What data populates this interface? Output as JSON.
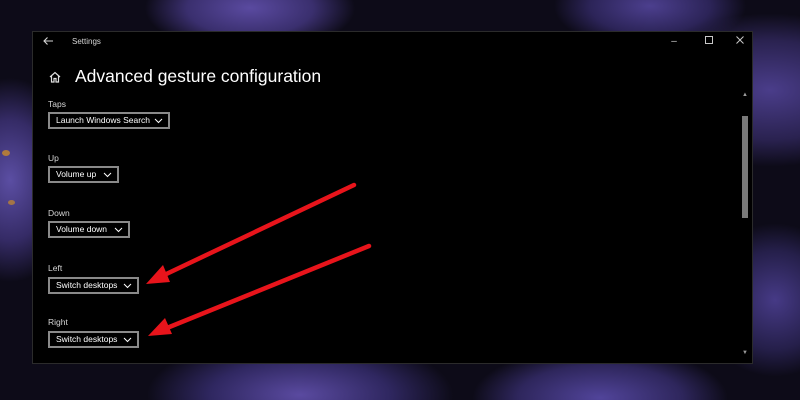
{
  "window": {
    "app_title": "Settings",
    "controls": {
      "minimize": "–",
      "maximize": "☐",
      "close": "✕"
    }
  },
  "header": {
    "title": "Advanced gesture configuration"
  },
  "gestures": [
    {
      "label": "Taps",
      "value": "Launch Windows Search"
    },
    {
      "label": "Up",
      "value": "Volume up"
    },
    {
      "label": "Down",
      "value": "Volume down"
    },
    {
      "label": "Left",
      "value": "Switch desktops"
    },
    {
      "label": "Right",
      "value": "Switch desktops"
    }
  ],
  "icons": {
    "back": "back-arrow-icon",
    "home": "home-icon",
    "dropdown": "chevron-down-icon"
  },
  "colors": {
    "window_bg": "#000000",
    "annotation_arrow": "#e8141b",
    "wallpaper_accent": "#5a4aa0"
  }
}
